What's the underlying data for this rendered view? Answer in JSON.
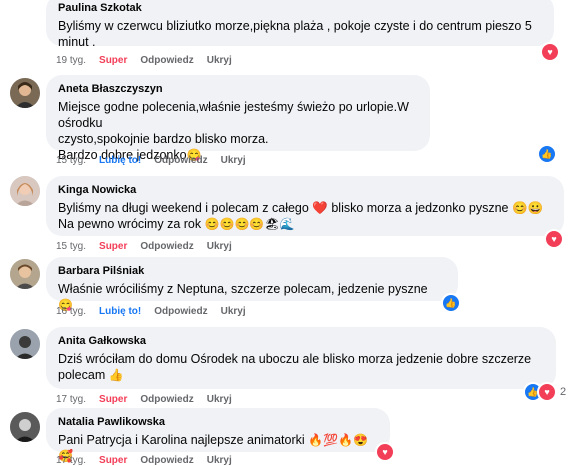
{
  "comments": [
    {
      "author": "Paulina Szkotak",
      "text": "Byliśmy w czerwcu bliziutko morze,piękna plaża , pokoje czyste i do centrum pieszo 5\nminut .",
      "time": "19 tyg.",
      "reaction_label": "Super",
      "reply_label": "Odpowiedz",
      "hide_label": "Ukryj",
      "reactions": [
        "heart-icon"
      ]
    },
    {
      "author": "Aneta Błaszczyszyn",
      "text": "Miejsce godne polecenia,właśnie jesteśmy świeżo po urlopie.W ośrodku\nczysto,spokojnie bardzo blisko morza.\nBardzo dobre jedzonko",
      "emoji": "😋",
      "time": "15 tyg.",
      "reaction_label": "Lubię to!",
      "reply_label": "Odpowiedz",
      "hide_label": "Ukryj",
      "reactions": [
        "thumb-icon"
      ]
    },
    {
      "author": "Kinga Nowicka",
      "text": "Byliśmy na długi weekend i polecam z całego ❤️ blisko morza a jedzonko pyszne 😊😀\nNa pewno wrócimy za rok",
      "emoji": "😊😊😊😊🏖🌊",
      "time": "15 tyg.",
      "reaction_label": "Super",
      "reply_label": "Odpowiedz",
      "hide_label": "Ukryj",
      "reactions": [
        "heart-icon"
      ]
    },
    {
      "author": "Barbara Pilśniak",
      "text": "Właśnie wróciliśmy z Neptuna, szczerze polecam, jedzenie pyszne",
      "emoji": "😋",
      "time": "16 tyg.",
      "reaction_label": "Lubię to!",
      "reply_label": "Odpowiedz",
      "hide_label": "Ukryj",
      "reactions": [
        "thumb-icon"
      ]
    },
    {
      "author": "Anita Gałkowska",
      "text": "Dziś wróciłam do domu Ośrodek na uboczu ale blisko morza jedzenie dobre szczerze\npolecam",
      "emoji": "👍",
      "time": "17 tyg.",
      "reaction_label": "Super",
      "reply_label": "Odpowiedz",
      "hide_label": "Ukryj",
      "reactions": [
        "thumb-icon",
        "heart-icon"
      ],
      "reaction_count": "2"
    },
    {
      "author": "Natalia Pawlikowska",
      "text": "Pani Patrycja i Karolina najlepsze animatorki",
      "emoji": "🔥💯🔥😍🥰",
      "time": "17 tyg.",
      "reaction_label": "Super",
      "reply_label": "Odpowiedz",
      "hide_label": "Ukryj",
      "reactions": [
        "heart-icon"
      ]
    }
  ],
  "colors": {
    "bubble": "#f0f2f5",
    "secondary_text": "#65676b",
    "super": "#f33e58",
    "like": "#1877f2"
  }
}
